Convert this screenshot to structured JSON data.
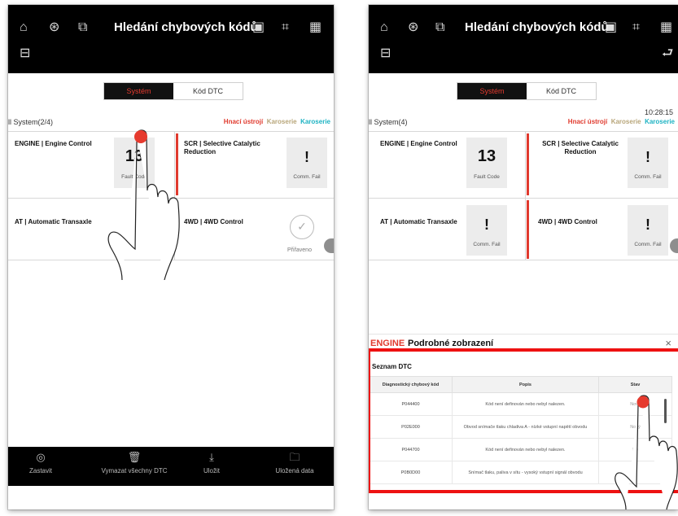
{
  "left": {
    "header_title": "Hledání chybových kódů",
    "tabs": {
      "system": "Systém",
      "dtc": "Kód DTC"
    },
    "system_count": "ll System(2/4)",
    "filters": [
      "Hnací ústrojí",
      "Karoserie",
      "Karoserie"
    ],
    "cards": {
      "engine": {
        "name": "ENGINE | Engine Control",
        "value": "13",
        "caption": "Fault Code"
      },
      "scr": {
        "name": "SCR | Selective Catalytic Reduction",
        "symbol": "!",
        "caption": "Comm. Fail"
      },
      "at": {
        "name": "AT | Automatic Transaxle",
        "caption": "C"
      },
      "fwd": {
        "name": "4WD | 4WD Control",
        "caption": "Přiřaveno"
      }
    },
    "bottom": [
      {
        "icon": "stop-icon",
        "label": "Zastavit"
      },
      {
        "icon": "trash-icon",
        "label": "Vymazat všechny DTC"
      },
      {
        "icon": "download-icon",
        "label": "Uložit"
      },
      {
        "icon": "folder-icon",
        "label": "Uložená data"
      }
    ]
  },
  "right": {
    "header_title": "Hledání chybových kódů",
    "tabs": {
      "system": "Systém",
      "dtc": "Kód DTC"
    },
    "time": "10:28:15",
    "system_count": "ll System(4)",
    "filters": [
      "Hnací ústrojí",
      "Karoserie",
      "Karoserie"
    ],
    "cards": {
      "engine": {
        "name": "ENGINE | Engine Control",
        "value": "13",
        "caption": "Fault Code"
      },
      "scr": {
        "name": "SCR | Selective Catalytic Reduction",
        "symbol": "!",
        "caption": "Comm. Fail"
      },
      "at": {
        "name": "AT | Automatic Transaxle",
        "symbol": "!",
        "caption": "Comm. Fail"
      },
      "fwd": {
        "name": "4WD | 4WD Control",
        "symbol": "!",
        "caption": "Comm. Fail"
      }
    },
    "panel": {
      "system": "ENGINE",
      "title": "Podrobné zobrazení",
      "close": "×",
      "list_title": "Seznam DTC",
      "columns": [
        "Diagnostický chybový kód",
        "Popis",
        "Stav"
      ],
      "rows": [
        {
          "code": "P044400",
          "desc": "Kód není definován nebo nebyl nalezen.",
          "status": "Nový"
        },
        {
          "code": "P02E000",
          "desc": "Obvod snímače tlaku chladiva A - nízké vstupní napětí obvodu",
          "status": "Nový"
        },
        {
          "code": "P044700",
          "desc": "Kód není definován nebo nebyl nalezen.",
          "status": "Ne"
        },
        {
          "code": "P0B0D00",
          "desc": "Snímač tlaku, paliva v sítu - vysoký vstupní signál obvodu",
          "status": ""
        }
      ]
    }
  },
  "colors": {
    "accent_red": "#e03a2e",
    "tan": "#b8a67a",
    "cyan": "#1eb3c3",
    "highlight": "#ee1111"
  }
}
